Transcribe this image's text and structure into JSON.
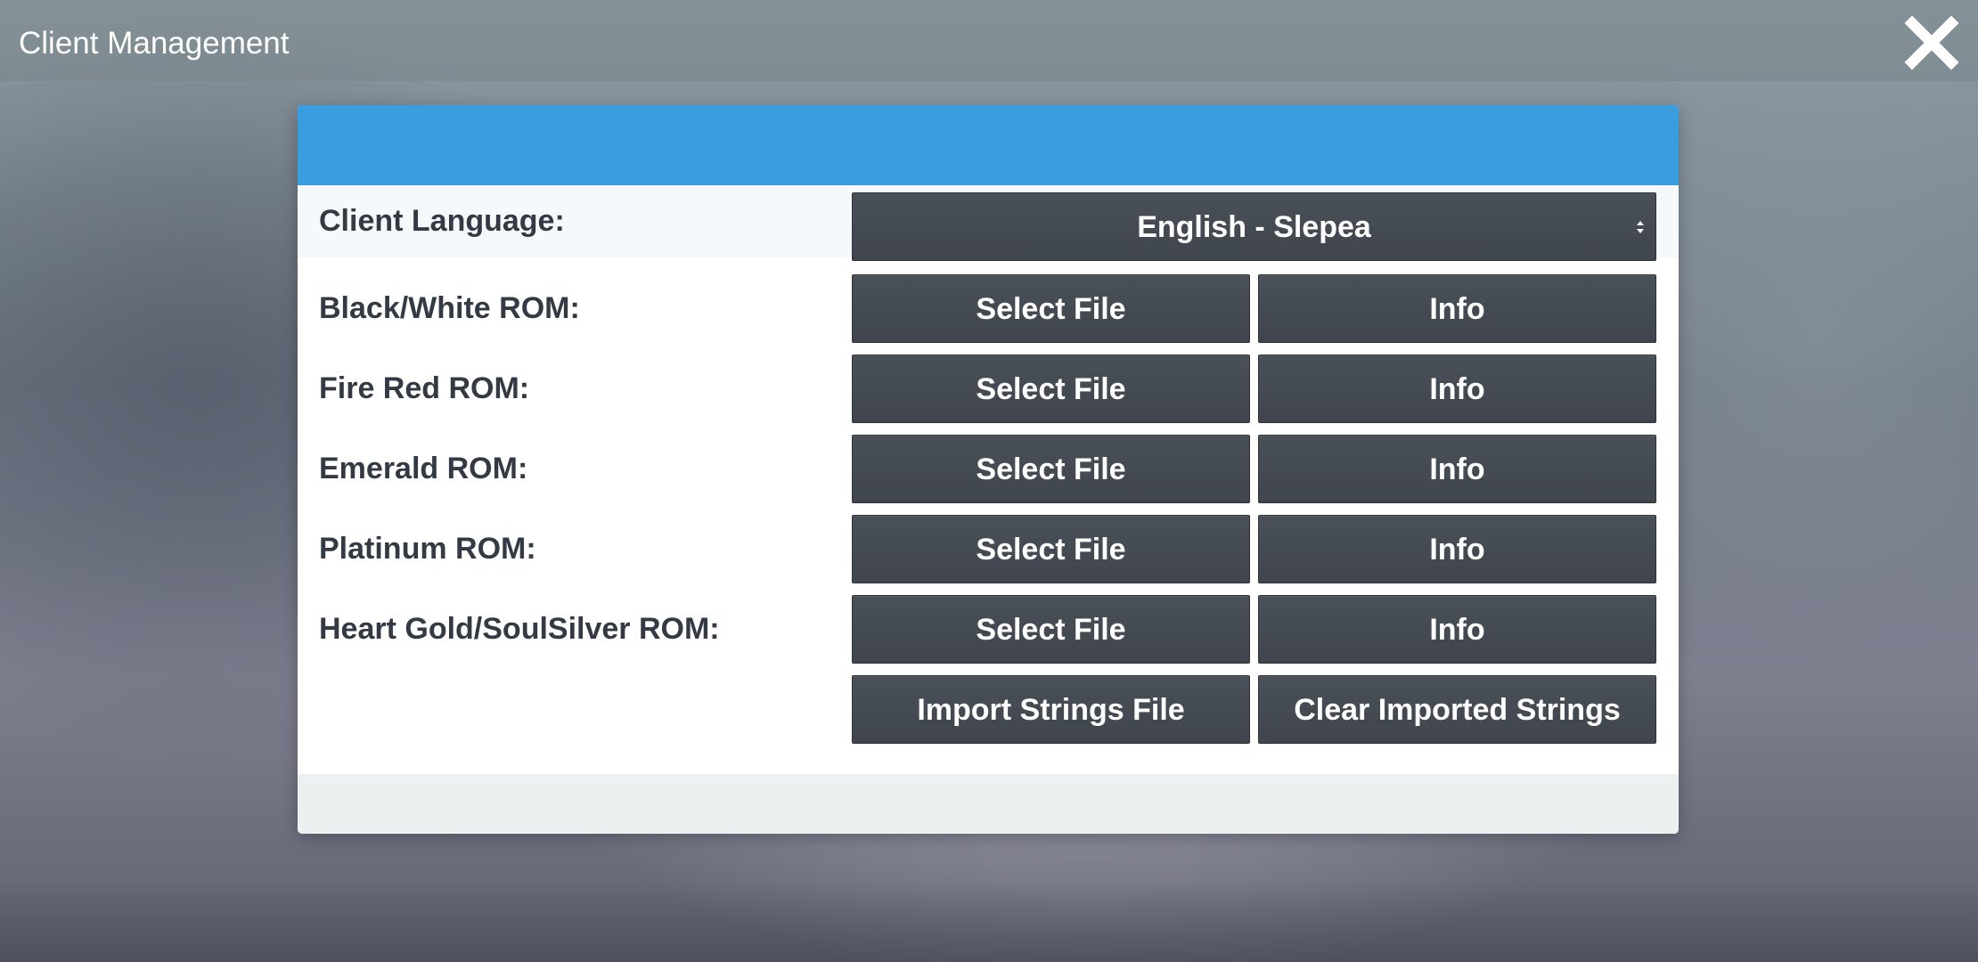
{
  "window": {
    "title": "Client Management",
    "close_icon": "close-icon"
  },
  "dialog": {
    "header_color": "#3a9ddf",
    "language": {
      "label": "Client Language:",
      "selected": "English - Slepea"
    },
    "roms": [
      {
        "label": "Black/White ROM:",
        "select_label": "Select File",
        "info_label": "Info"
      },
      {
        "label": "Fire Red ROM:",
        "select_label": "Select File",
        "info_label": "Info"
      },
      {
        "label": "Emerald ROM:",
        "select_label": "Select File",
        "info_label": "Info"
      },
      {
        "label": "Platinum ROM:",
        "select_label": "Select File",
        "info_label": "Info"
      },
      {
        "label": "Heart Gold/SoulSilver ROM:",
        "select_label": "Select File",
        "info_label": "Info"
      }
    ],
    "strings": {
      "import_label": "Import Strings File",
      "clear_label": "Clear Imported Strings"
    }
  }
}
